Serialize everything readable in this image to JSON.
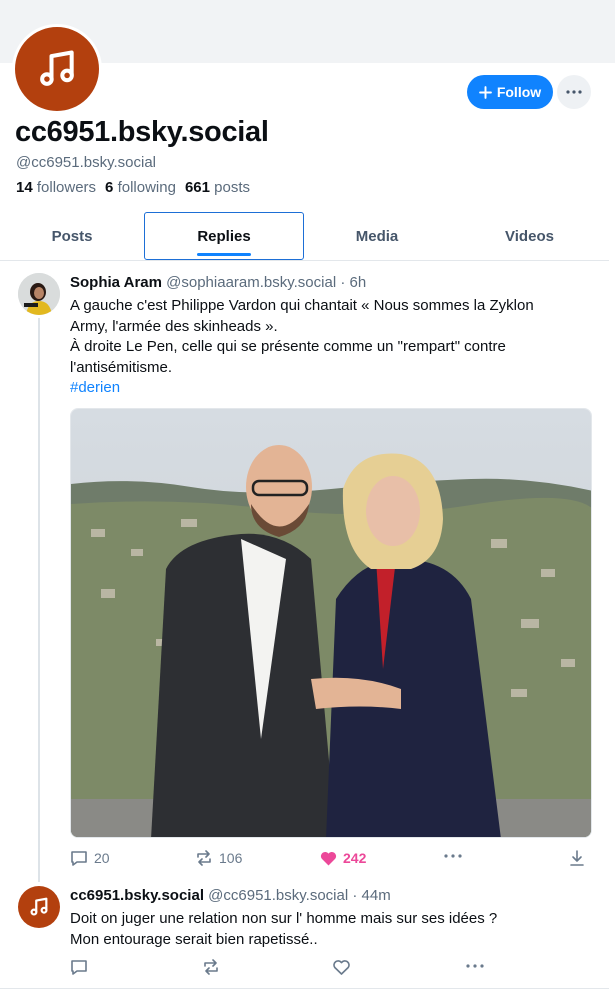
{
  "profile": {
    "display_name": "cc6951.bsky.social",
    "handle": "@cc6951.bsky.social",
    "followers_count": "14",
    "followers_label": "followers",
    "following_count": "6",
    "following_label": "following",
    "posts_count": "661",
    "posts_label": "posts",
    "avatar_icon": "music-note-icon",
    "avatar_color": "#b3400e"
  },
  "actions": {
    "follow_label": "Follow",
    "more_icon": "ellipsis-icon"
  },
  "tabs": [
    {
      "label": "Posts",
      "active": false
    },
    {
      "label": "Replies",
      "active": true
    },
    {
      "label": "Media",
      "active": false
    },
    {
      "label": "Videos",
      "active": false
    }
  ],
  "posts": [
    {
      "author": "Sophia Aram",
      "handle": "@sophiaaram.bsky.social",
      "time": "· 6h",
      "text_lines": [
        "A gauche c'est Philippe Vardon qui chantait  « Nous sommes la Zyklon",
        "Army, l'armée des skinheads ».",
        "À droite Le Pen, celle qui se présente comme un \"rempart\" contre",
        "l'antisémitisme."
      ],
      "hashtag": "#derien",
      "replies": "20",
      "reposts": "106",
      "likes": "242"
    },
    {
      "author": "cc6951.bsky.social",
      "handle": "@cc6951.bsky.social",
      "time": "· 44m",
      "text_lines": [
        "Doit on juger une relation non sur l' homme mais sur ses idées ?",
        "Mon entourage serait bien rapetissé.."
      ]
    }
  ],
  "colors": {
    "accent": "#1083fe",
    "like": "#ec4899",
    "muted": "#5b6b7c"
  }
}
